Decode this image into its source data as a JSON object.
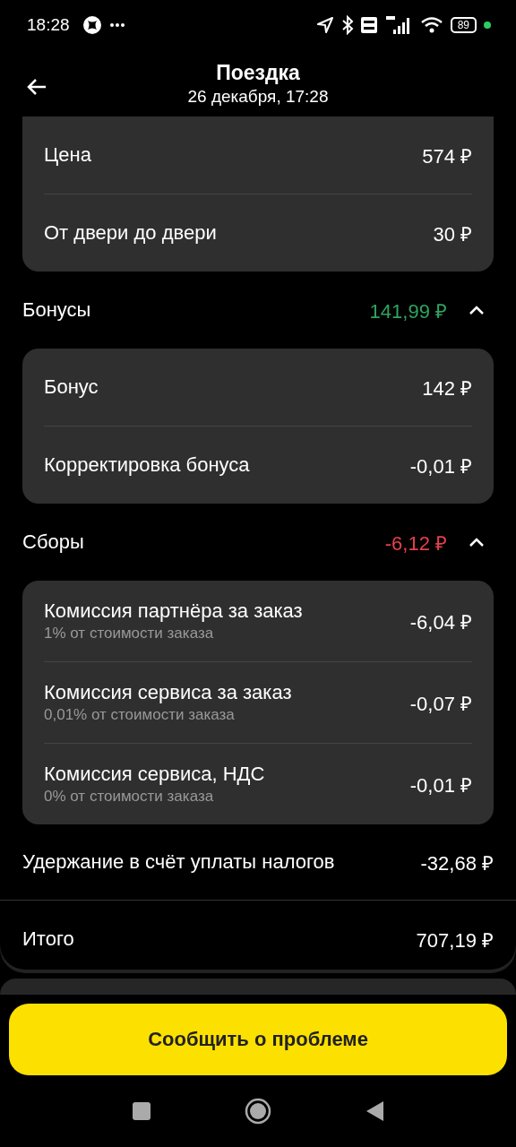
{
  "status_bar": {
    "time": "18:28",
    "battery": "89"
  },
  "header": {
    "title": "Поездка",
    "subtitle": "26 декабря, 17:28"
  },
  "top_card": {
    "rows": [
      {
        "label": "Цена",
        "amount": "574 ₽"
      },
      {
        "label": "От двери до двери",
        "amount": "30 ₽"
      }
    ]
  },
  "sections": [
    {
      "title": "Бонусы",
      "total": "141,99 ₽",
      "color": "#2fa35f",
      "expanded": true,
      "rows": [
        {
          "label": "Бонус",
          "amount": "142 ₽"
        },
        {
          "label": "Корректировка бонуса",
          "amount": "-0,01 ₽"
        }
      ]
    },
    {
      "title": "Сборы",
      "total": "-6,12 ₽",
      "color": "#e5404a",
      "expanded": true,
      "rows": [
        {
          "label": "Комиссия партнёра за заказ",
          "note": "1% от стоимости заказа",
          "amount": "-6,04 ₽"
        },
        {
          "label": "Комиссия сервиса за заказ",
          "note": "0,01% от стоимости заказа",
          "amount": "-0,07 ₽"
        },
        {
          "label": "Комиссия сервиса, НДС",
          "note": "0% от стоимости заказа",
          "amount": "-0,01 ₽"
        }
      ]
    }
  ],
  "tax": {
    "label": "Удержание в счёт уплаты налогов",
    "amount": "-32,68 ₽"
  },
  "total": {
    "label": "Итого",
    "amount": "707,19 ₽"
  },
  "report_button": "Сообщить о проблеме"
}
